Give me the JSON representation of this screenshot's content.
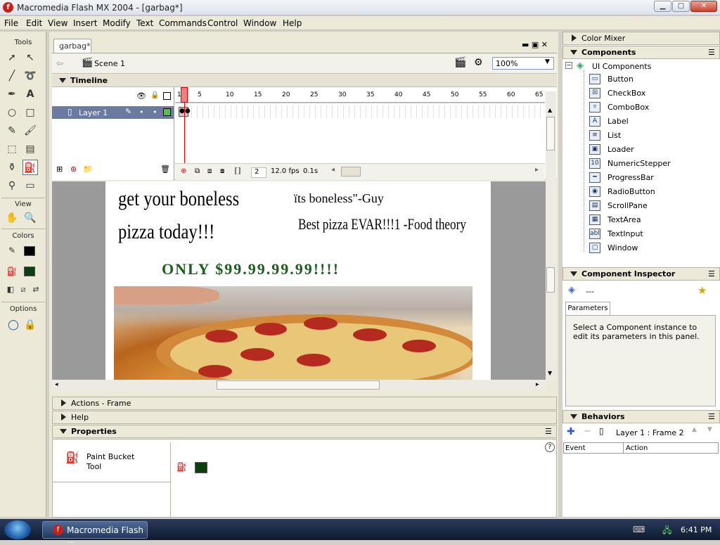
{
  "window": {
    "title": "Macromedia Flash MX 2004 - [garbag*]",
    "logo_letter": "f"
  },
  "menubar": [
    "File",
    "Edit",
    "View",
    "Insert",
    "Modify",
    "Text",
    "Commands",
    "Control",
    "Window",
    "Help"
  ],
  "tools": {
    "title": "Tools",
    "view_label": "View",
    "colors_label": "Colors",
    "options_label": "Options",
    "stroke_color": "#000000",
    "fill_color": "#0f3d12"
  },
  "document": {
    "tab": "garbag*",
    "scene": "Scene 1",
    "zoom": "100%",
    "timeline_label": "Timeline",
    "layer_name": "Layer 1",
    "frame_numbers": [
      "1",
      "5",
      "10",
      "15",
      "20",
      "25",
      "30",
      "35",
      "40",
      "45",
      "50",
      "55",
      "60",
      "65"
    ],
    "current_frame": "2",
    "fps": "12.0 fps",
    "elapsed": "0.1s"
  },
  "stage": {
    "headline1": "get your boneless",
    "headline2": "pizza today!!!",
    "quote1": "ïts boneless\"-Guy",
    "quote2": "Best pizza EVAR!!!1 -Food theory",
    "price": "ONLY $99.99.99.99!!!!",
    "price_color": "#1a5e1a"
  },
  "panels": {
    "actions": "Actions - Frame",
    "help": "Help",
    "properties": "Properties",
    "tool_name_line1": "Paint Bucket",
    "tool_name_line2": "Tool"
  },
  "right": {
    "color_mixer": "Color Mixer",
    "components": "Components",
    "ui_components": "UI Components",
    "component_list": [
      "Button",
      "CheckBox",
      "ComboBox",
      "Label",
      "List",
      "Loader",
      "NumericStepper",
      "ProgressBar",
      "RadioButton",
      "ScrollPane",
      "TextArea",
      "TextInput",
      "Window"
    ],
    "component_icons": [
      "▭",
      "☒",
      "▿",
      "A",
      "≡",
      "▣",
      "10",
      "━",
      "◉",
      "▤",
      "▦",
      "abl",
      "▢"
    ],
    "inspector": "Component Inspector",
    "inspector_value": "---",
    "parameters_tab": "Parameters",
    "inspector_msg": "Select a Component instance to edit its parameters in this panel.",
    "behaviors": "Behaviors",
    "behaviors_target": "Layer 1 : Frame 2",
    "col_event": "Event",
    "col_action": "Action"
  },
  "taskbar": {
    "button": "Macromedia Flash ...",
    "time": "6:41 PM"
  }
}
